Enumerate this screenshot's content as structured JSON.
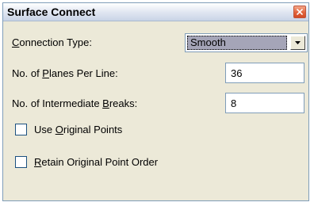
{
  "window": {
    "title": "Surface Connect",
    "close_icon": "close-icon"
  },
  "connection_type": {
    "label_pre": "",
    "label_key": "C",
    "label_post": "onnection Type:",
    "selected": "Smooth"
  },
  "planes_per_line": {
    "label_pre": "No. of ",
    "label_key": "P",
    "label_post": "lanes Per Line:",
    "value": "36"
  },
  "intermediate_breaks": {
    "label_pre": "No. of Intermediate ",
    "label_key": "B",
    "label_post": "reaks:",
    "value": "8"
  },
  "use_original_points": {
    "label_pre": "Use ",
    "label_key": "O",
    "label_post": "riginal Points",
    "checked": false
  },
  "retain_point_order": {
    "label_pre": "",
    "label_key": "R",
    "label_post": "etain Original Point Order",
    "checked": false
  }
}
